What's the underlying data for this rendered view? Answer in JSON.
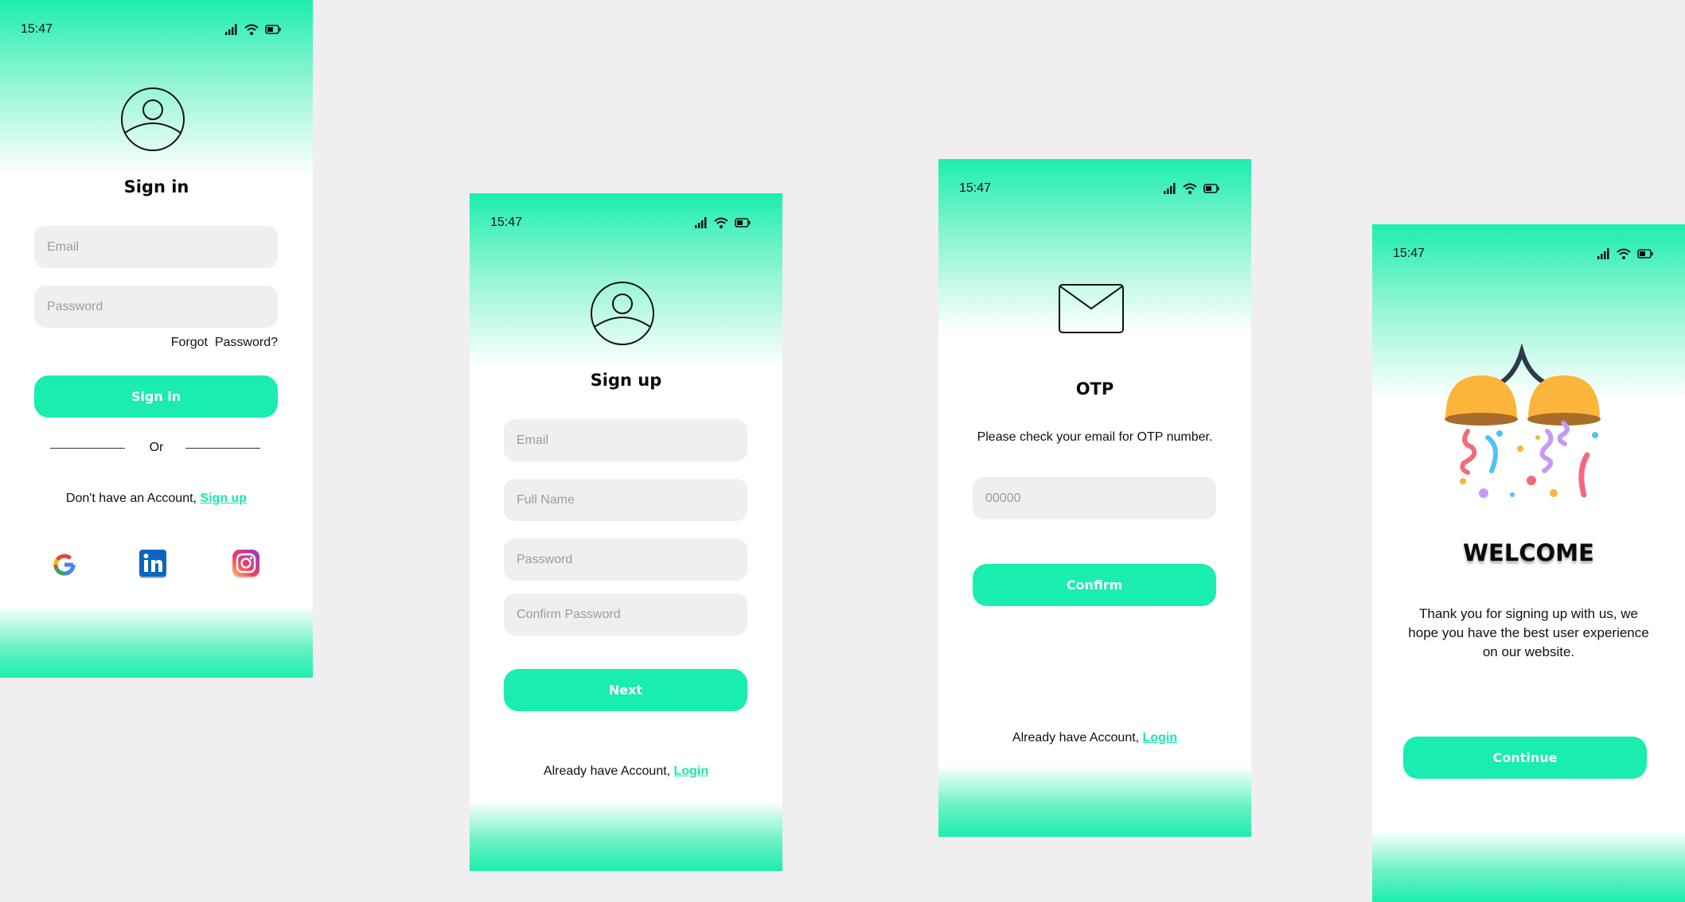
{
  "status_bar": {
    "time": "15:47"
  },
  "signin": {
    "title": "Sign in",
    "email_placeholder": "Email",
    "password_placeholder": "Password",
    "forgot_password": "Forgot  Password?",
    "button": "Sign in",
    "divider": "Or",
    "no_account_text": "Don't have an Account, ",
    "signup_link": "Sign up",
    "socials": [
      "google-icon",
      "linkedin-icon",
      "instagram-icon"
    ]
  },
  "signup": {
    "title": "Sign up",
    "email_placeholder": "Email",
    "fullname_placeholder": "Full Name",
    "password_placeholder": "Password",
    "confirm_password_placeholder": "Confirm Password",
    "button": "Next",
    "have_account_text": "Already have Account, ",
    "login_link": "Login"
  },
  "otp": {
    "title": "OTP",
    "message": "Please check your email for OTP number.",
    "code_placeholder": "00000",
    "button": "Confirm",
    "have_account_text": "Already have Account, ",
    "login_link": "Login"
  },
  "welcome": {
    "title": "WELCOME",
    "message": "Thank you for signing up with us, we hope you have the best user experience on our website.",
    "button": "Continue"
  },
  "colors": {
    "accent": "#19edb0",
    "background": "#f0eeef",
    "field": "#f0eeef"
  }
}
